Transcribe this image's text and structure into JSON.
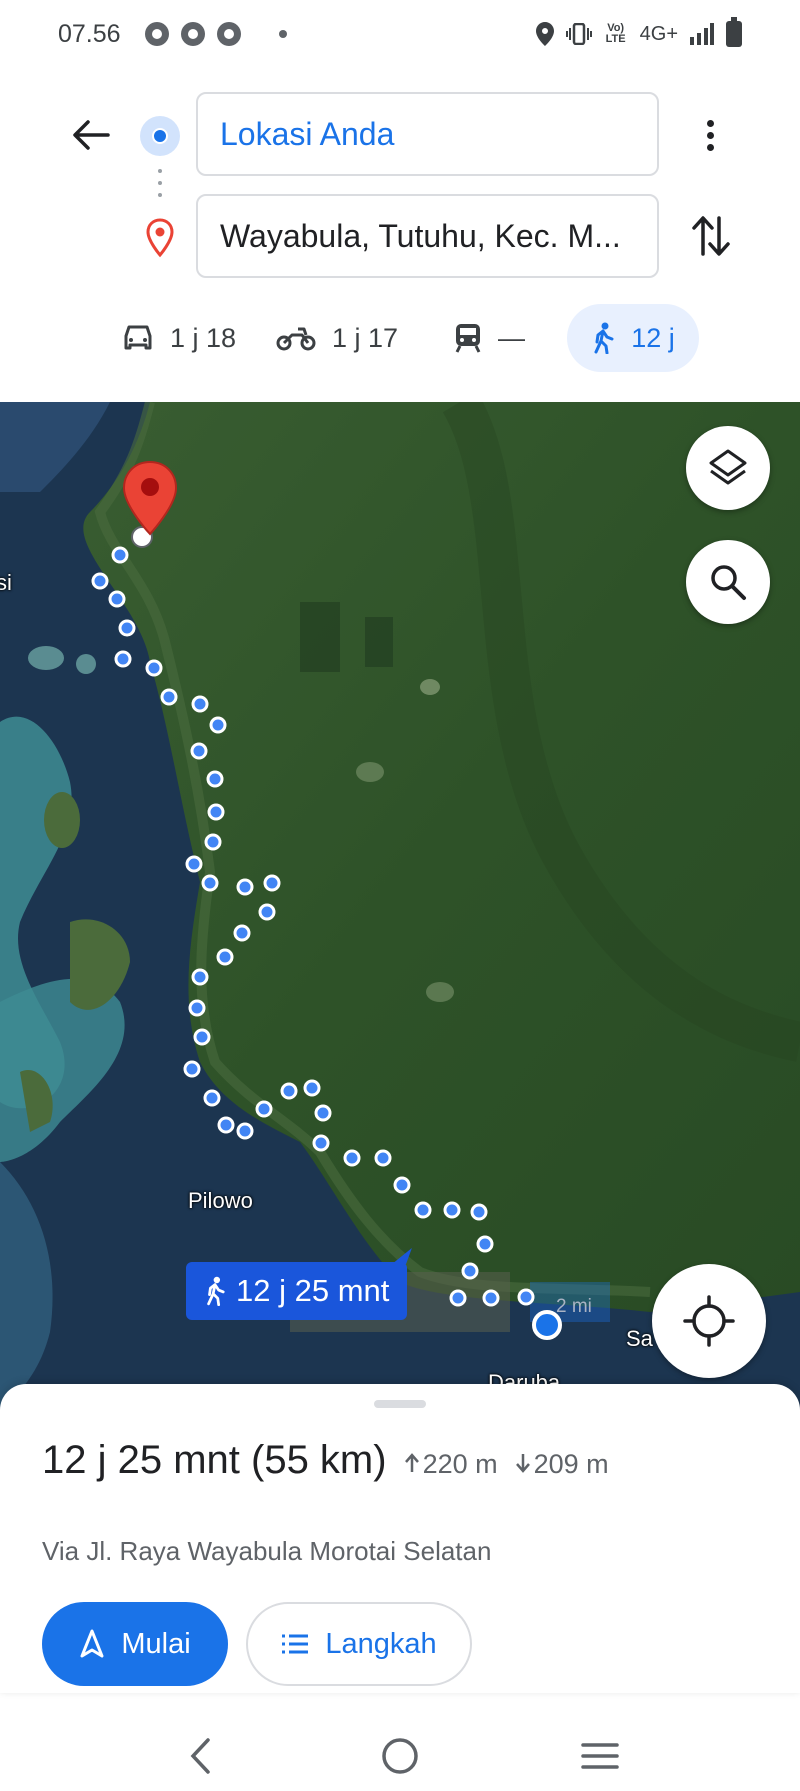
{
  "status_bar": {
    "time": "07.56",
    "app_icons": [
      "chrome-icon",
      "chrome-icon",
      "chrome-icon"
    ],
    "right_icons": [
      "location-icon",
      "vibrate-icon",
      "volte-icon",
      "network-4g-icon",
      "signal-icon",
      "battery-icon"
    ],
    "network": "4G+",
    "volte": "Vo) LTE"
  },
  "header": {
    "origin": "Lokasi Anda",
    "destination": "Wayabula, Tutuhu, Kec. M...",
    "modes": [
      {
        "icon": "car-icon",
        "label": "1 j 18"
      },
      {
        "icon": "motorcycle-icon",
        "label": "1 j 17"
      },
      {
        "icon": "transit-icon",
        "label": "—"
      },
      {
        "icon": "walk-icon",
        "label": "12 j",
        "selected": true
      }
    ]
  },
  "map": {
    "labels": {
      "pilowo": "Pilowo",
      "daruba": "Daruba",
      "sa": "Sa",
      "si": "si"
    },
    "duration_chip": "12 j 25 mnt",
    "scale": "2 mi",
    "colors": {
      "route": "#1a73e8",
      "pin": "#ea4335"
    }
  },
  "sheet": {
    "summary": "12 j 25 mnt (55 km)",
    "ascent": "220 m",
    "descent": "209 m",
    "via": "Via Jl. Raya Wayabula Morotai Selatan",
    "start_label": "Mulai",
    "steps_label": "Langkah"
  },
  "nav": [
    "back-icon",
    "home-icon",
    "recents-icon"
  ]
}
